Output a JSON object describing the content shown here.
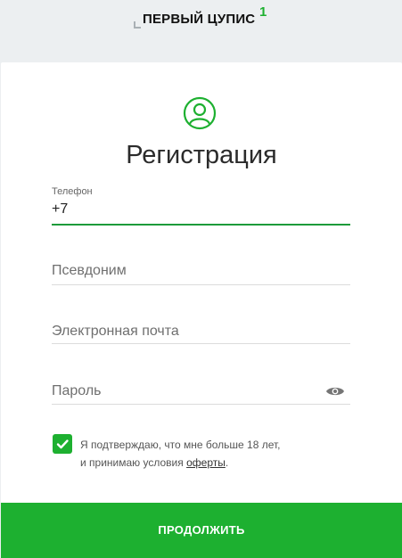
{
  "header": {
    "logo_text": "ПЕРВЫЙ ЦУПИС",
    "logo_sup": "1"
  },
  "form": {
    "title": "Регистрация",
    "avatar_icon": "user-circle-icon",
    "phone": {
      "label": "Телефон",
      "value": "+7"
    },
    "nickname": {
      "placeholder": "Псевдоним"
    },
    "email": {
      "placeholder": "Электронная почта"
    },
    "password": {
      "placeholder": "Пароль",
      "toggle_icon": "eye-icon"
    },
    "consent": {
      "checked": true,
      "line1": "Я подтверждаю, что мне больше 18 лет,",
      "line2_prefix": "и принимаю условия ",
      "link": "оферты",
      "line2_suffix": "."
    },
    "submit_label": "ПРОДОЛЖИТЬ"
  },
  "colors": {
    "accent": "#1db030",
    "active_underline": "#1d9b3a",
    "background": "#eceff1"
  }
}
